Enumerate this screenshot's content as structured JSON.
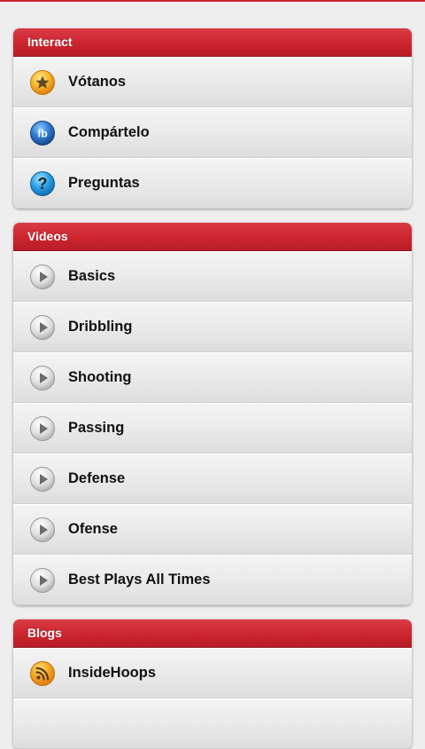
{
  "sections": [
    {
      "title": "Interact",
      "items": [
        {
          "label": "Vótanos",
          "icon": "star-icon"
        },
        {
          "label": "Compártelo",
          "icon": "facebook-icon"
        },
        {
          "label": "Preguntas",
          "icon": "question-icon"
        }
      ]
    },
    {
      "title": "Videos",
      "items": [
        {
          "label": "Basics",
          "icon": "play-icon"
        },
        {
          "label": "Dribbling",
          "icon": "play-icon"
        },
        {
          "label": "Shooting",
          "icon": "play-icon"
        },
        {
          "label": "Passing",
          "icon": "play-icon"
        },
        {
          "label": "Defense",
          "icon": "play-icon"
        },
        {
          "label": "Ofense",
          "icon": "play-icon"
        },
        {
          "label": "Best Plays All Times",
          "icon": "play-icon"
        }
      ]
    },
    {
      "title": "Blogs",
      "items": [
        {
          "label": "InsideHoops",
          "icon": "rss-icon"
        },
        {
          "label": "",
          "icon": ""
        }
      ]
    }
  ],
  "colors": {
    "header_red": "#cc2530",
    "background": "#eeeeee",
    "star_orange": "#f2a21d",
    "facebook_blue": "#2f7bd4",
    "question_blue": "#29a2e8",
    "play_gray": "#d9d9d9",
    "rss_orange": "#f39a1b"
  }
}
